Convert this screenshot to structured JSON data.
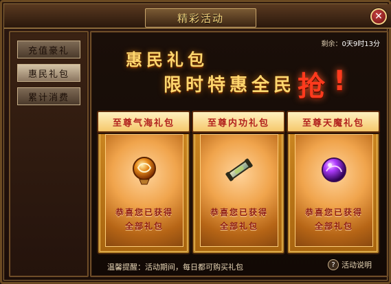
{
  "window": {
    "title": "精彩活动",
    "close_label": "✕"
  },
  "sidebar": {
    "items": [
      {
        "label": "充值豪礼",
        "active": false
      },
      {
        "label": "惠民礼包",
        "active": true
      },
      {
        "label": "累计消费",
        "active": false
      }
    ]
  },
  "banner": {
    "line1": "惠民礼包",
    "line2": "限时特惠全民",
    "highlight": "抢",
    "exclaim": "!"
  },
  "timer": {
    "label": "剩余：",
    "value": "0天9时13分"
  },
  "cards": [
    {
      "title": "至尊气海礼包",
      "icon": "orb-qi-icon",
      "line1": "恭喜您已获得",
      "line2": "全部礼包"
    },
    {
      "title": "至尊内功礼包",
      "icon": "scroll-icon",
      "line1": "恭喜您已获得",
      "line2": "全部礼包"
    },
    {
      "title": "至尊天魔礼包",
      "icon": "purple-orb-icon",
      "line1": "恭喜您已获得",
      "line2": "全部礼包"
    }
  ],
  "footer": {
    "note": "温馨提醒：活动期间，每日都可购买礼包"
  },
  "help": {
    "icon": "question-icon",
    "label": "活动说明"
  },
  "colors": {
    "gold": "#ffd76e",
    "accent_red": "#ff3a1d",
    "frame": "#6e4d28"
  }
}
